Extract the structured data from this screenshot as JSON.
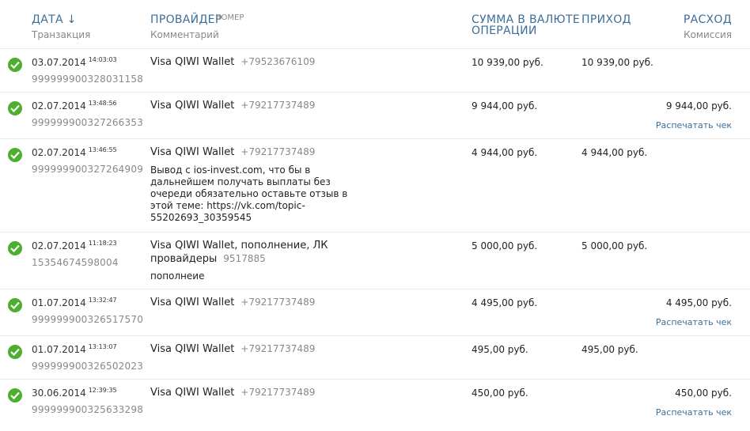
{
  "header": {
    "date_label": "ДАТА ↓",
    "txn_label": "Транзакция",
    "provider_label": "ПРОВАЙДЕР",
    "number_label": "НОМЕР",
    "comment_label": "Комментарий",
    "amount_label_line1": "СУММА В ВАЛЮТЕ",
    "amount_label_line2": "ОПЕРАЦИИ",
    "income_label": "ПРИХОД",
    "expense_label": "РАСХОД",
    "commission_label": "Комиссия"
  },
  "rows": [
    {
      "date": "03.07.2014",
      "time": "14:03:03",
      "txn": "999999900328031158",
      "provider": "Visa QIWI Wallet",
      "number": "+79523676109",
      "amount": "10 939,00 руб.",
      "income": "10 939,00 руб.",
      "expense": "",
      "receipt": ""
    },
    {
      "date": "02.07.2014",
      "time": "13:48:56",
      "txn": "999999900327266353",
      "provider": "Visa QIWI Wallet",
      "number": "+79217737489",
      "amount": "9 944,00 руб.",
      "income": "",
      "expense": "9 944,00 руб.",
      "receipt": "Распечатать чек"
    },
    {
      "date": "02.07.2014",
      "time": "13:46:55",
      "txn": "999999900327264909",
      "provider": "Visa QIWI Wallet",
      "number": "+79217737489",
      "comment": "Вывод с ios-invest.com, что бы в дальнейшем получать выплаты без очереди обязательно оставьте отзыв в этой теме: https://vk.com/topic-55202693_30359545",
      "amount": "4 944,00 руб.",
      "income": "4 944,00 руб.",
      "expense": "",
      "receipt": ""
    },
    {
      "date": "02.07.2014",
      "time": "11:18:23",
      "txn": "15354674598004",
      "provider_line1": "Visa QIWI Wallet, пополнение, ЛК",
      "provider_line2": "провайдеры",
      "number": "9517885",
      "comment": "пополнеие",
      "amount": "5 000,00 руб.",
      "income": "5 000,00 руб.",
      "expense": "",
      "receipt": ""
    },
    {
      "date": "01.07.2014",
      "time": "13:32:47",
      "txn": "999999900326517570",
      "provider": "Visa QIWI Wallet",
      "number": "+79217737489",
      "amount": "4 495,00 руб.",
      "income": "",
      "expense": "4 495,00 руб.",
      "receipt": "Распечатать чек"
    },
    {
      "date": "01.07.2014",
      "time": "13:13:07",
      "txn": "999999900326502023",
      "provider": "Visa QIWI Wallet",
      "number": "+79217737489",
      "amount": "495,00 руб.",
      "income": "495,00 руб.",
      "expense": "",
      "receipt": ""
    },
    {
      "date": "30.06.2014",
      "time": "12:39:35",
      "txn": "999999900325633298",
      "provider": "Visa QIWI Wallet",
      "number": "+79217737489",
      "amount": "450,00 руб.",
      "income": "",
      "expense": "450,00 руб.",
      "receipt": "Распечатать чек"
    }
  ],
  "colors": {
    "accent": "#3b6e99",
    "success": "#4caf2e"
  },
  "icons": {
    "status": "check-circle-icon"
  }
}
